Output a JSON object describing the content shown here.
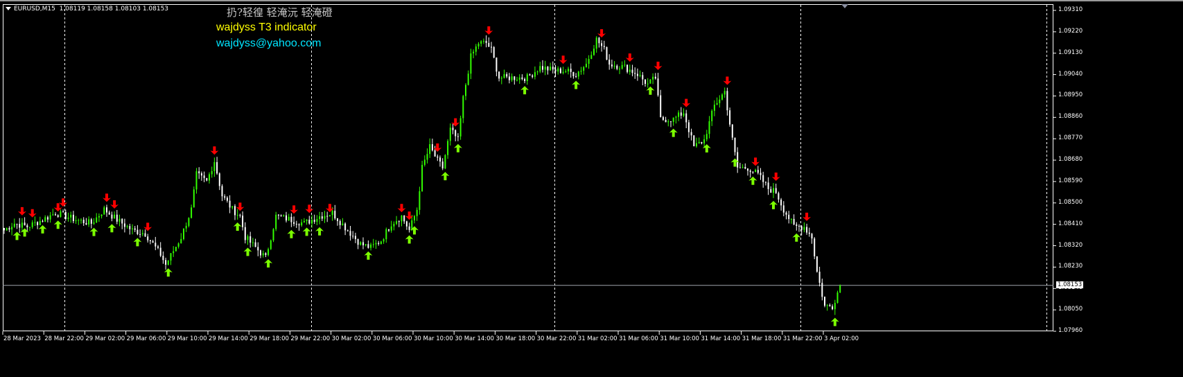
{
  "header": {
    "symbol": "EURUSD,M15",
    "ohlc": "1.08119 1.08158 1.08103 1.08153"
  },
  "overlay": {
    "title": "扔?轻徨 轻淹沅 轻淹磴",
    "indicator": "wajdyss T3 indicator",
    "email": "wajdyss@yahoo.com"
  },
  "colors": {
    "bull": "#32ff00",
    "bear": "#ffffff",
    "sell_arrow": "#ff0000",
    "buy_arrow": "#7cff00",
    "bid_line": "#a0a4ac",
    "background": "#000000"
  },
  "chart_data": {
    "type": "candlestick",
    "title": "EURUSD,M15",
    "ylim": [
      1.0796,
      1.0931
    ],
    "yticks": [
      "1.09310",
      "1.09220",
      "1.09130",
      "1.09040",
      "1.08950",
      "1.08860",
      "1.08770",
      "1.08680",
      "1.08590",
      "1.08500",
      "1.08410",
      "1.08320",
      "1.08230",
      "1.08140",
      "1.08050",
      "1.07960"
    ],
    "current_price": "1.08153",
    "xticks": [
      "28 Mar 2023",
      "28 Mar 22:00",
      "29 Mar 02:00",
      "29 Mar 06:00",
      "29 Mar 10:00",
      "29 Mar 14:00",
      "29 Mar 18:00",
      "29 Mar 22:00",
      "30 Mar 02:00",
      "30 Mar 06:00",
      "30 Mar 10:00",
      "30 Mar 14:00",
      "30 Mar 18:00",
      "30 Mar 22:00",
      "31 Mar 02:00",
      "31 Mar 06:00",
      "31 Mar 10:00",
      "31 Mar 14:00",
      "31 Mar 18:00",
      "31 Mar 22:00",
      "3 Apr 02:00"
    ],
    "bars_per_xtick": 16,
    "day_separator_bars": [
      24,
      120,
      215,
      311,
      407
    ],
    "close_path": [
      [
        0,
        1.08385
      ],
      [
        4,
        1.08414
      ],
      [
        9,
        1.084
      ],
      [
        15,
        1.08429
      ],
      [
        20,
        1.08458
      ],
      [
        24,
        1.08444
      ],
      [
        28,
        1.08429
      ],
      [
        34,
        1.08414
      ],
      [
        39,
        1.08473
      ],
      [
        44,
        1.08429
      ],
      [
        50,
        1.08385
      ],
      [
        55,
        1.08371
      ],
      [
        61,
        1.08283
      ],
      [
        63,
        1.0824
      ],
      [
        69,
        1.08356
      ],
      [
        73,
        1.08473
      ],
      [
        75,
        1.08619
      ],
      [
        79,
        1.0859
      ],
      [
        82,
        1.08677
      ],
      [
        85,
        1.08531
      ],
      [
        89,
        1.08473
      ],
      [
        92,
        1.08444
      ],
      [
        94,
        1.08356
      ],
      [
        98,
        1.08312
      ],
      [
        102,
        1.08269
      ],
      [
        106,
        1.08444
      ],
      [
        112,
        1.08429
      ],
      [
        117,
        1.08414
      ],
      [
        123,
        1.08444
      ],
      [
        128,
        1.08458
      ],
      [
        134,
        1.08385
      ],
      [
        139,
        1.08327
      ],
      [
        143,
        1.08312
      ],
      [
        147,
        1.08342
      ],
      [
        151,
        1.08414
      ],
      [
        155,
        1.08444
      ],
      [
        158,
        1.08385
      ],
      [
        161,
        1.08473
      ],
      [
        163,
        1.08648
      ],
      [
        166,
        1.08735
      ],
      [
        169,
        1.08677
      ],
      [
        171,
        1.08648
      ],
      [
        174,
        1.08808
      ],
      [
        177,
        1.08765
      ],
      [
        179,
        1.0894
      ],
      [
        182,
        1.09115
      ],
      [
        185,
        1.09173
      ],
      [
        188,
        1.09173
      ],
      [
        190,
        1.09144
      ],
      [
        193,
        1.09027
      ],
      [
        198,
        1.09027
      ],
      [
        204,
        1.09027
      ],
      [
        209,
        1.09071
      ],
      [
        215,
        1.09056
      ],
      [
        219,
        1.09056
      ],
      [
        223,
        1.09042
      ],
      [
        227,
        1.09085
      ],
      [
        231,
        1.09188
      ],
      [
        234,
        1.09144
      ],
      [
        236,
        1.09085
      ],
      [
        242,
        1.09071
      ],
      [
        247,
        1.09042
      ],
      [
        251,
        1.08998
      ],
      [
        254,
        1.09027
      ],
      [
        256,
        1.08852
      ],
      [
        261,
        1.08852
      ],
      [
        265,
        1.08881
      ],
      [
        269,
        1.08735
      ],
      [
        273,
        1.08765
      ],
      [
        277,
        1.0891
      ],
      [
        281,
        1.08969
      ],
      [
        284,
        1.08765
      ],
      [
        286,
        1.08648
      ],
      [
        290,
        1.08648
      ],
      [
        294,
        1.08619
      ],
      [
        298,
        1.0856
      ],
      [
        301,
        1.08546
      ],
      [
        304,
        1.08473
      ],
      [
        308,
        1.084
      ],
      [
        312,
        1.084
      ],
      [
        315,
        1.08356
      ],
      [
        317,
        1.0821
      ],
      [
        320,
        1.08065
      ],
      [
        323,
        1.08065
      ],
      [
        326,
        1.08153
      ]
    ],
    "sell_arrows": [
      7,
      11,
      21,
      23,
      40,
      43,
      56,
      82,
      92,
      113,
      119,
      127,
      155,
      158,
      169,
      176,
      189,
      218,
      233,
      244,
      255,
      266,
      282,
      293,
      301,
      313
    ],
    "buy_arrows": [
      5,
      8,
      15,
      21,
      35,
      42,
      52,
      64,
      91,
      95,
      103,
      112,
      118,
      123,
      142,
      158,
      160,
      172,
      177,
      203,
      223,
      252,
      261,
      274,
      285,
      292,
      300,
      309,
      324
    ]
  }
}
